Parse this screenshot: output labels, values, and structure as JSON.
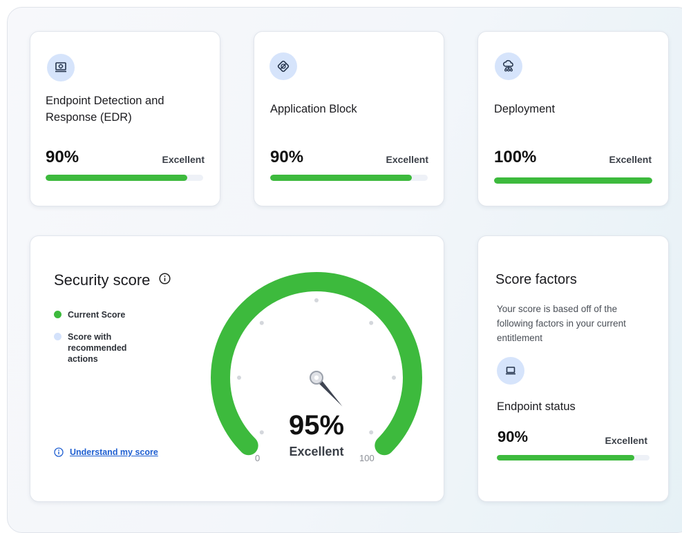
{
  "cards": [
    {
      "icon": "laptop-target-icon",
      "title": "Endpoint Detection and Response (EDR)",
      "percent_label": "90%",
      "value": 0.9,
      "rating": "Excellent"
    },
    {
      "icon": "shield-block-icon",
      "title": "Application Block",
      "percent_label": "90%",
      "value": 0.9,
      "rating": "Excellent"
    },
    {
      "icon": "cloud-network-icon",
      "title": "Deployment",
      "percent_label": "100%",
      "value": 1.0,
      "rating": "Excellent"
    }
  ],
  "security": {
    "title": "Security score",
    "legend": [
      {
        "label": "Current Score",
        "color": "#3dba3d"
      },
      {
        "label": "Score with recommended actions",
        "color": "#d4e2fb"
      }
    ],
    "link_label": "Understand my score",
    "gauge": {
      "value_label": "95%",
      "value": 0.95,
      "rating": "Excellent",
      "min_label": "0",
      "max_label": "100",
      "color": "#3dba3d"
    }
  },
  "factors": {
    "title": "Score factors",
    "description": "Your score is based off of the following factors in your current entitlement",
    "item": {
      "icon": "laptop-icon",
      "title": "Endpoint status",
      "percent_label": "90%",
      "value": 0.9,
      "rating": "Excellent"
    }
  },
  "colors": {
    "accent": "#3dba3d",
    "icon_bg": "#d6e4fb",
    "link": "#1f5fd1",
    "track": "#eef1f7"
  }
}
